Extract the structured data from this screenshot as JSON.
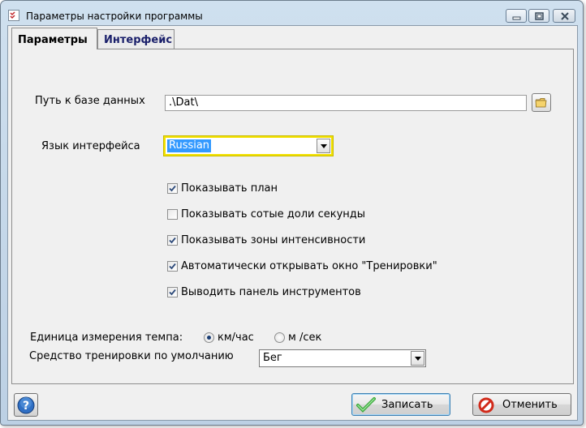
{
  "window": {
    "title": "Параметры настройки программы",
    "accent": "#bcd0e4"
  },
  "tabs": [
    {
      "label": "Параметры",
      "active": true
    },
    {
      "label": "Интерфейс",
      "active": false
    }
  ],
  "database": {
    "label": "Путь к базе данных",
    "path_value": ".\\Dat\\",
    "browse_icon": "folder-icon"
  },
  "language": {
    "label": "Язык интерфейса",
    "selected": "Russian"
  },
  "options": [
    {
      "label": "Показывать план",
      "checked": true
    },
    {
      "label": "Показывать сотые доли секунды",
      "checked": false
    },
    {
      "label": "Показывать зоны интенсивности",
      "checked": true
    },
    {
      "label": "Автоматически открывать окно \"Тренировки\"",
      "checked": true
    },
    {
      "label": "Выводить панель инструментов",
      "checked": true
    }
  ],
  "pace_unit": {
    "label": "Единица измерения темпа:",
    "choices": [
      {
        "label": "км/час",
        "selected": true
      },
      {
        "label": "м /сек",
        "selected": false
      }
    ]
  },
  "default_trainer": {
    "label": "Средство тренировки по умолчанию",
    "selected": "Бег"
  },
  "buttons": {
    "help_icon": "help-icon",
    "save_label": "Записать",
    "save_icon": "checkmark-icon",
    "cancel_label": "Отменить",
    "cancel_icon": "cancel-icon"
  }
}
